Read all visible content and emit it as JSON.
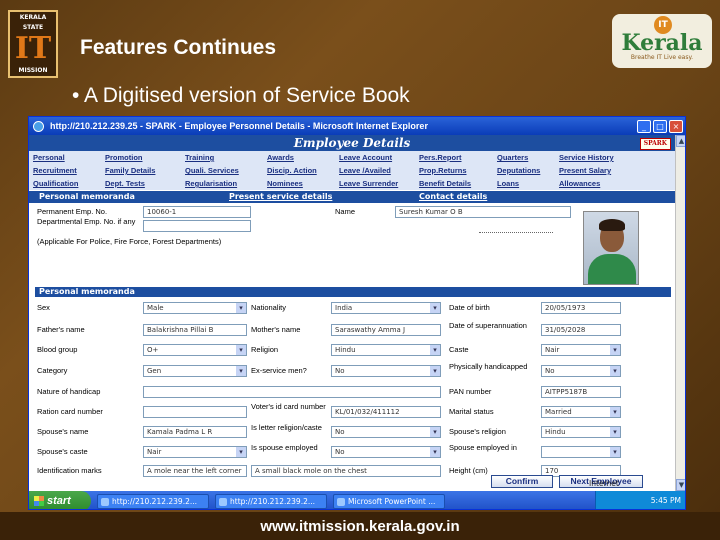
{
  "slide": {
    "logo_left_line1": "KERALA",
    "logo_left_line2": "STATE",
    "logo_left_big": "IT",
    "logo_left_line3": "MISSION",
    "title": "Features Continues",
    "bullet": "• A Digitised version of Service Book",
    "logo_right_badge": "IT",
    "logo_right_word": "Kerala",
    "logo_right_tag": "Breathe IT Live easy.",
    "footer_url": "www.itmission.kerala.gov.in"
  },
  "window": {
    "title": "http://210.212.239.25 - SPARK - Employee Personnel Details - Microsoft Internet Explorer",
    "page_heading": "Employee Details",
    "spark_label": "SPARK",
    "menu": [
      "Personal",
      "Promotion",
      "Training",
      "Awards",
      "Leave Account",
      "Pers.Report",
      "Quarters",
      "Service History",
      "Recruitment",
      "Family Details",
      "Quali. Services",
      "Discip. Action",
      "Leave /Availed",
      "Prop.Returns",
      "Deputations",
      "Present Salary",
      "Qualification",
      "Dept. Tests",
      "Regularisation",
      "Nominees",
      "Leave Surrender",
      "Benefit Details",
      "Loans",
      "Allowances"
    ],
    "tabs": {
      "personal": "Personal memoranda",
      "present_service": "Present service details",
      "contact": "Contact details"
    },
    "top_fields": {
      "permanent_emp_no_label": "Permanent Emp. No.",
      "permanent_emp_no_value": "10060-1",
      "name_label": "Name",
      "name_value": "Suresh Kumar O B",
      "dept_emp_no_label": "Departmental Emp. No. if any",
      "applicable_label": "(Applicable For Police, Fire Force, Forest Departments)"
    },
    "section2": "Personal memoranda",
    "rows": [
      {
        "l1": "Sex",
        "v1": "Male",
        "l2": "Nationality",
        "v2": "India",
        "l3": "Date of birth",
        "v3": "20/05/1973"
      },
      {
        "l1": "Father's name",
        "v1": "Balakrishna Pillai B",
        "l2": "Mother's name",
        "v2": "Saraswathy Amma J",
        "l3": "Date of superannuation",
        "v3": "31/05/2028"
      },
      {
        "l1": "Blood group",
        "v1": "O+",
        "l2": "Religion",
        "v2": "Hindu",
        "l3": "Caste",
        "v3": "Nair"
      },
      {
        "l1": "Category",
        "v1": "Gen",
        "l2": "Ex-service men?",
        "v2": "No",
        "l3": "Physically handicapped",
        "v3": "No"
      },
      {
        "l1": "Nature of handicap",
        "v1": "",
        "l2": "",
        "v2": "",
        "l3": "PAN number",
        "v3": "AITPP5187B"
      },
      {
        "l1": "Ration card number",
        "v1": "",
        "l2": "Voter's id card number",
        "v2": "KL/01/032/411112",
        "l3": "Marital status",
        "v3": "Married"
      },
      {
        "l1": "Spouse's name",
        "v1": "Kamala Padma L R",
        "l2": "Is letter religion/caste",
        "v2": "No",
        "l3": "Spouse's religion",
        "v3": "Hindu"
      },
      {
        "l1": "Spouse's caste",
        "v1": "Nair",
        "l2": "Is spouse employed",
        "v2": "No",
        "l3": "Spouse employed in",
        "v3": ""
      },
      {
        "l1": "Identification marks",
        "v1": "A mole near the left corner",
        "l2": "",
        "v2": "A small black mole on the chest",
        "l3": "Height (cm)",
        "v3": "170"
      }
    ],
    "buttons": {
      "confirm": "Confirm",
      "next": "Next Employee"
    },
    "status_internet": "Internet",
    "taskbar": {
      "start": "start",
      "items": [
        "http://210.212.239.2...",
        "http://210.212.239.2...",
        "Microsoft PowerPoint ..."
      ],
      "clock": "5:45 PM"
    }
  }
}
